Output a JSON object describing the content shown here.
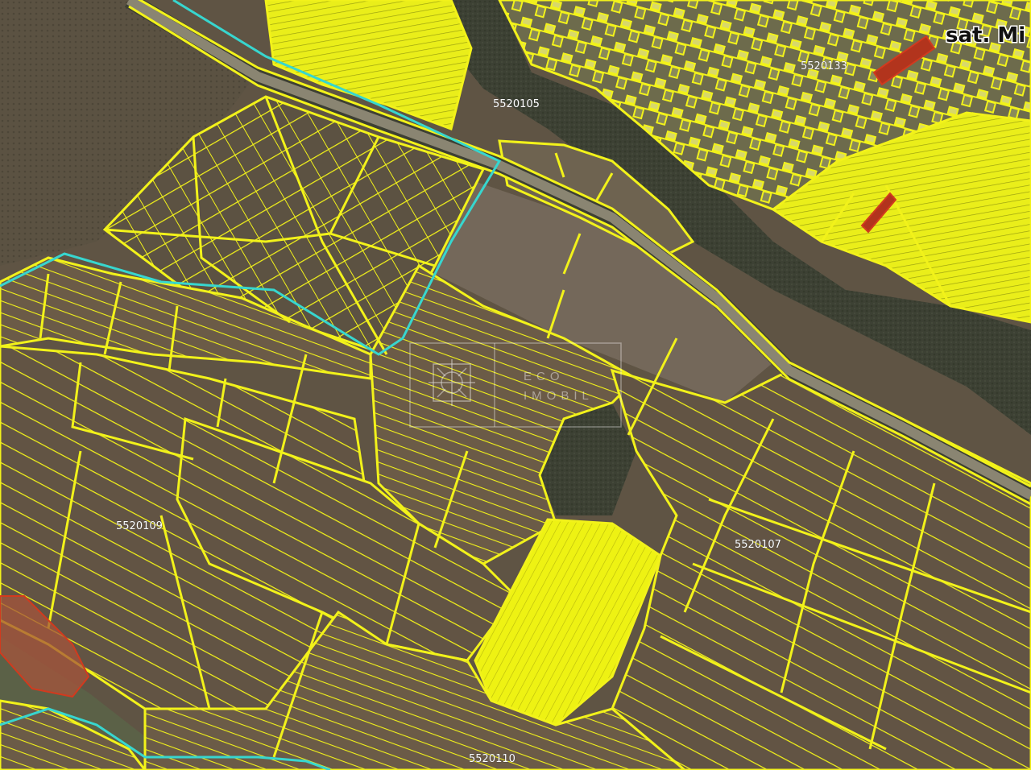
{
  "map": {
    "village_label": "sat. Mi",
    "cadastral_labels": {
      "north": "5520105",
      "village": "5520133",
      "west": "5520109",
      "east": "5520107",
      "south": "5520110"
    },
    "watermark": {
      "line1": "ECO",
      "line2": "IMOBIL"
    },
    "colors": {
      "parcel_boundary": "#f2f21a",
      "parcel_fill": "#eef213",
      "sector_boundary": "#37d6cf",
      "highlight_parcel": "#c8411e",
      "road": "#8a8572",
      "forest": "#3c4134",
      "field": "#6a5a48"
    }
  }
}
